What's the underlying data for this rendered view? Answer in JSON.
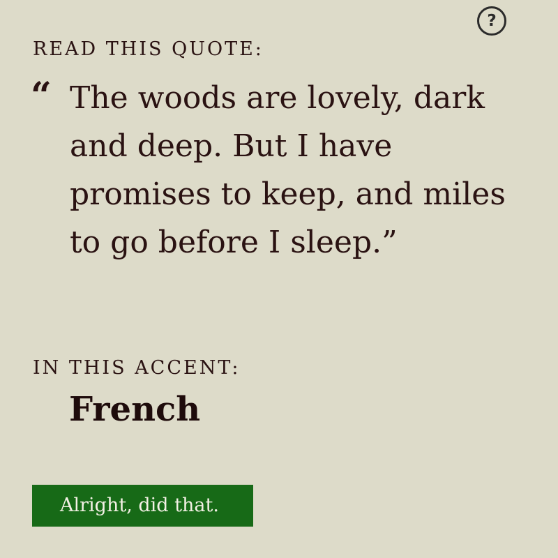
{
  "help": {
    "icon": "question-circle-icon",
    "glyph": "?"
  },
  "quote": {
    "label": "READ THIS QUOTE:",
    "open_mark": "“",
    "text": "The woods are lovely, dark and deep. But I have promises to keep, and miles to go before I sleep.”"
  },
  "accent": {
    "label": "IN THIS ACCENT:",
    "value": "French"
  },
  "action": {
    "label": "Alright, did that."
  },
  "colors": {
    "background": "#dddbc9",
    "text": "#2a1212",
    "button": "#176a17",
    "button_text": "#f4f1e6"
  }
}
